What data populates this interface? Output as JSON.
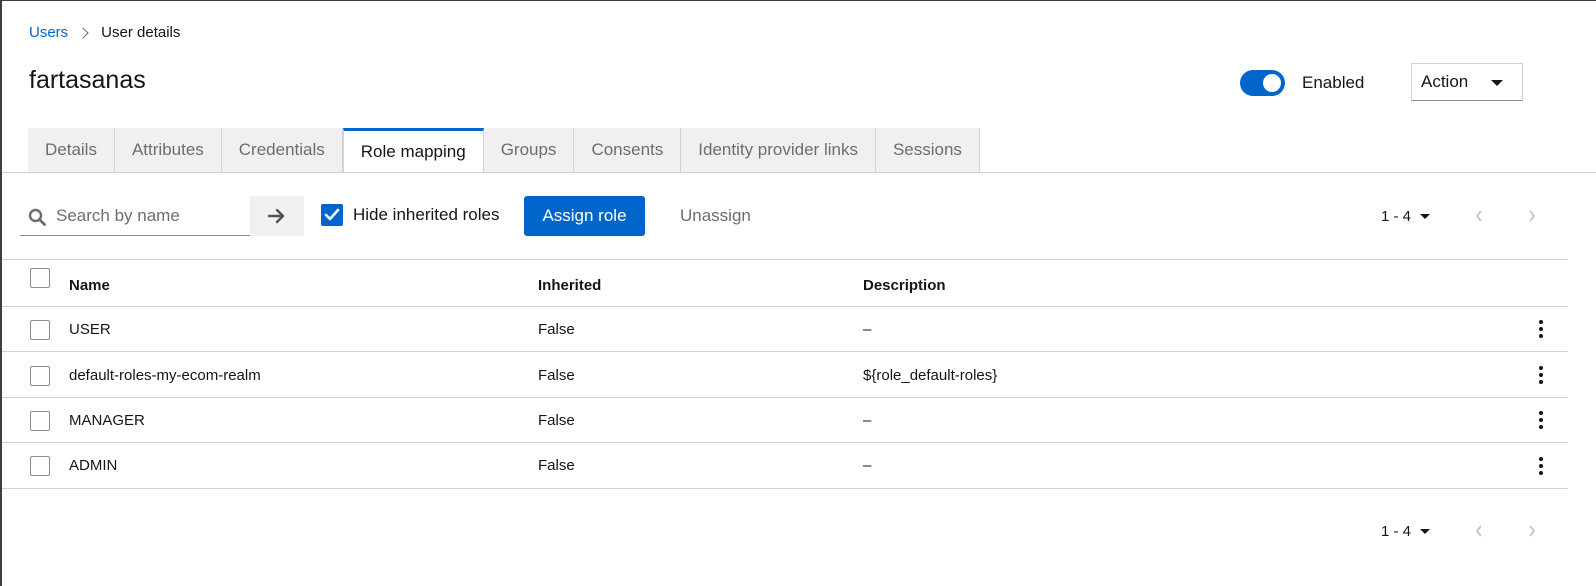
{
  "breadcrumb": {
    "parent": "Users",
    "current": "User details"
  },
  "page": {
    "title": "fartasanas"
  },
  "header": {
    "enabled_label": "Enabled",
    "enabled": true,
    "action_label": "Action"
  },
  "tabs": [
    {
      "label": "Details",
      "active": false
    },
    {
      "label": "Attributes",
      "active": false
    },
    {
      "label": "Credentials",
      "active": false
    },
    {
      "label": "Role mapping",
      "active": true
    },
    {
      "label": "Groups",
      "active": false
    },
    {
      "label": "Consents",
      "active": false
    },
    {
      "label": "Identity provider links",
      "active": false
    },
    {
      "label": "Sessions",
      "active": false
    }
  ],
  "toolbar": {
    "search_placeholder": "Search by name",
    "search_value": "",
    "hide_inherited_label": "Hide inherited roles",
    "hide_inherited_checked": true,
    "assign_label": "Assign role",
    "unassign_label": "Unassign"
  },
  "pagination": {
    "range": "1 - 4"
  },
  "table": {
    "columns": [
      "Name",
      "Inherited",
      "Description"
    ],
    "rows": [
      {
        "name": "USER",
        "inherited": "False",
        "description": "–"
      },
      {
        "name": "default-roles-my-ecom-realm",
        "inherited": "False",
        "description": "${role_default-roles}"
      },
      {
        "name": "MANAGER",
        "inherited": "False",
        "description": "–"
      },
      {
        "name": "ADMIN",
        "inherited": "False",
        "description": "–"
      }
    ]
  },
  "colors": {
    "accent": "#0066cc",
    "border": "#d2d2d2",
    "muted": "#6a6e73",
    "tab_bg": "#f0f0f0"
  },
  "icons": [
    "chevron-right-icon",
    "caret-down-icon",
    "search-icon",
    "arrow-right-icon",
    "checkmark-icon",
    "angle-left-icon",
    "angle-right-icon",
    "kebab-icon"
  ]
}
